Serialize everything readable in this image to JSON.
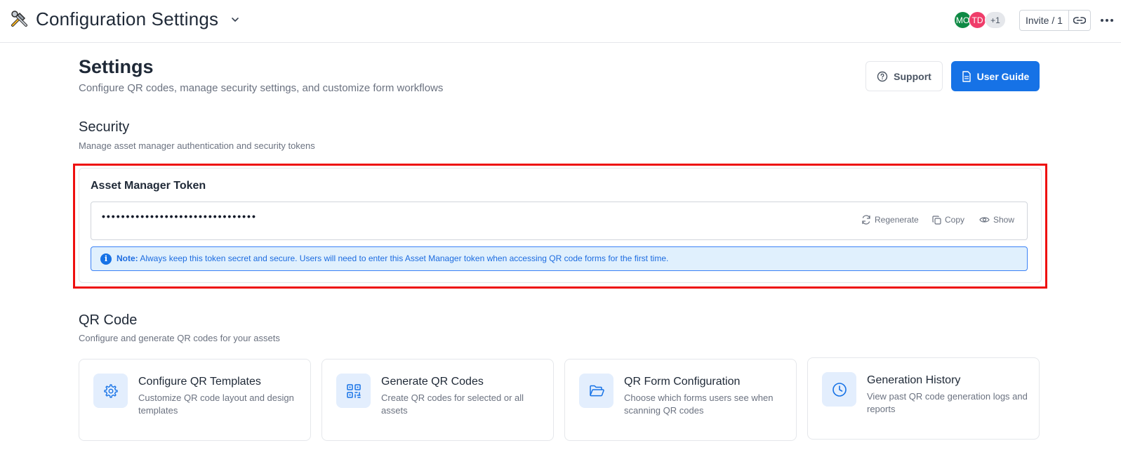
{
  "header": {
    "app_title": "Configuration Settings",
    "avatars": [
      "MO",
      "TD",
      "+1"
    ],
    "invite_label": "Invite / 1"
  },
  "page": {
    "title": "Settings",
    "subtitle": "Configure QR codes, manage security settings, and customize form workflows",
    "support_label": "Support",
    "guide_label": "User Guide"
  },
  "security": {
    "title": "Security",
    "subtitle": "Manage asset manager authentication and security tokens",
    "token_label": "Asset Manager Token",
    "token_value": "••••••••••••••••••••••••••••••••",
    "actions": {
      "regenerate": "Regenerate",
      "copy": "Copy",
      "show": "Show"
    },
    "note_prefix": "Note:",
    "note_text": "Always keep this token secret and secure. Users will need to enter this Asset Manager token when accessing QR code forms for the first time."
  },
  "qr": {
    "title": "QR Code",
    "subtitle": "Configure and generate QR codes for your assets",
    "cards": [
      {
        "icon": "gear-icon",
        "title": "Configure QR Templates",
        "desc": "Customize QR code layout and design templates"
      },
      {
        "icon": "qr-code-icon",
        "title": "Generate QR Codes",
        "desc": "Create QR codes for selected or all assets"
      },
      {
        "icon": "folder-open-icon",
        "title": "QR Form Configuration",
        "desc": "Choose which forms users see when scanning QR codes"
      },
      {
        "icon": "clock-icon",
        "title": "Generation History",
        "desc": "View past QR code generation logs and reports"
      }
    ]
  },
  "colors": {
    "primary": "#1672e6",
    "highlight": "#ee0f0f",
    "note_bg": "#e0f0fd"
  }
}
